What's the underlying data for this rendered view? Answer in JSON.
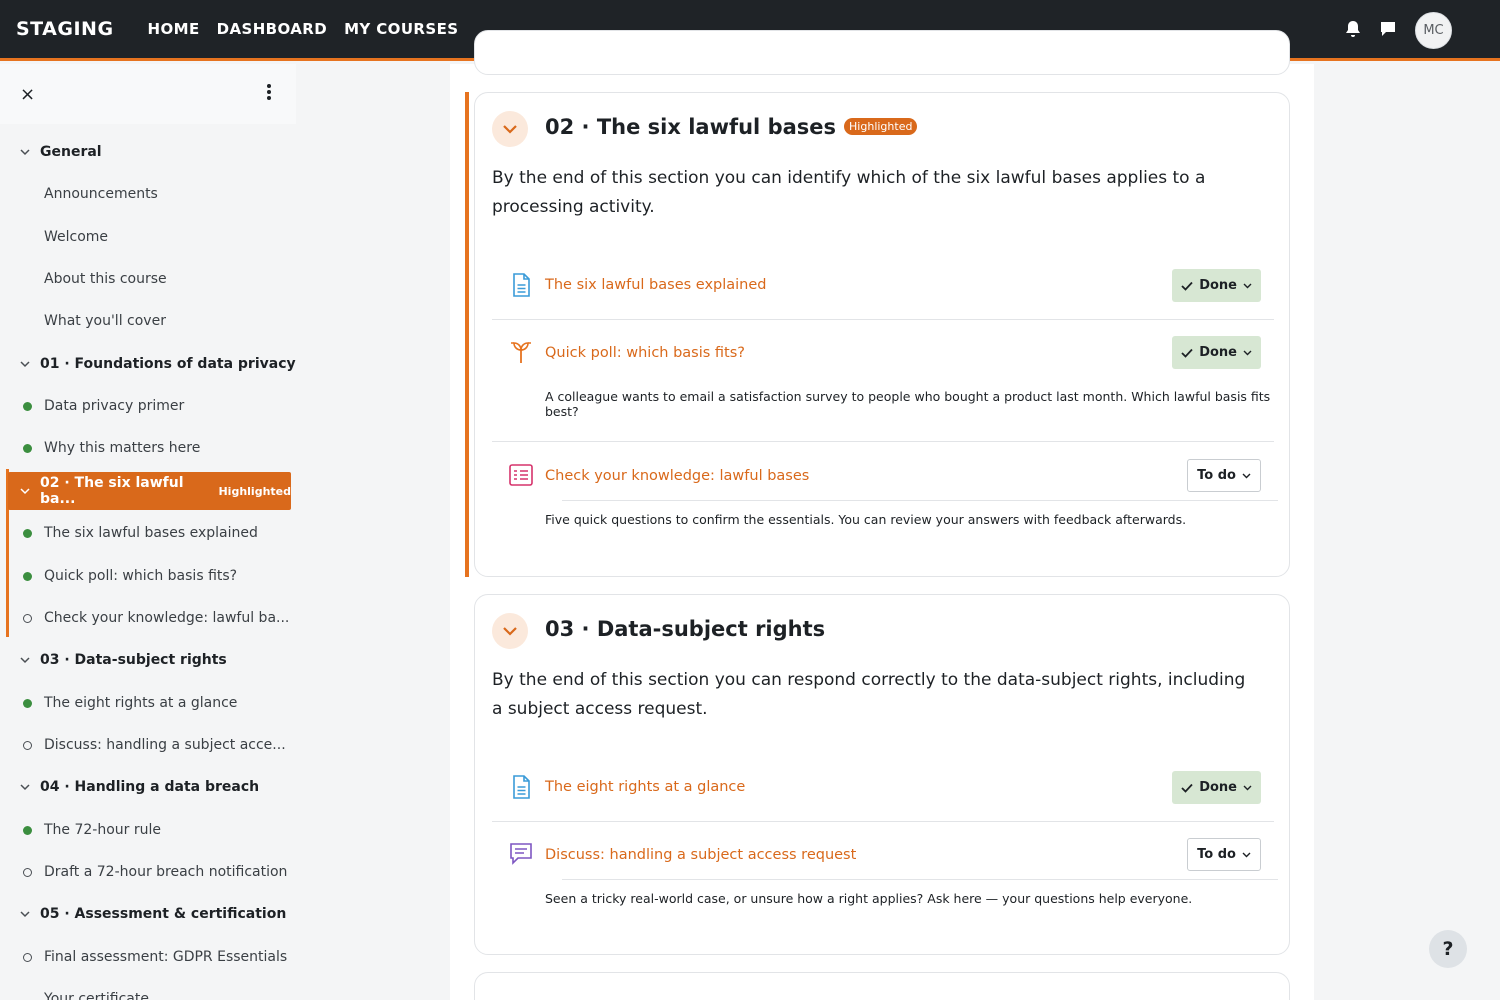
{
  "header": {
    "brand": "STAGING",
    "nav": [
      "HOME",
      "DASHBOARD",
      "MY COURSES"
    ],
    "avatar_initials": "MC",
    "accent_color": "#e6731f"
  },
  "drawer": {
    "close_icon": "×",
    "items": [
      {
        "kind": "section",
        "label": "General"
      },
      {
        "kind": "link",
        "label": "Announcements",
        "status": "none"
      },
      {
        "kind": "link",
        "label": "Welcome",
        "status": "none"
      },
      {
        "kind": "link",
        "label": "About this course",
        "status": "none"
      },
      {
        "kind": "link",
        "label": "What you'll cover",
        "status": "none"
      },
      {
        "kind": "section",
        "label": "01 · Foundations of data privacy"
      },
      {
        "kind": "link",
        "label": "Data privacy primer",
        "status": "done"
      },
      {
        "kind": "link",
        "label": "Why this matters here",
        "status": "done"
      },
      {
        "kind": "section",
        "label": "02 · The six lawful ba...",
        "active": true,
        "badge": "Highlighted"
      },
      {
        "kind": "link",
        "label": "The six lawful bases explained",
        "status": "done"
      },
      {
        "kind": "link",
        "label": "Quick poll: which basis fits?",
        "status": "done"
      },
      {
        "kind": "link",
        "label": "Check your knowledge: lawful ba...",
        "status": "todo"
      },
      {
        "kind": "section",
        "label": "03 · Data-subject rights"
      },
      {
        "kind": "link",
        "label": "The eight rights at a glance",
        "status": "done"
      },
      {
        "kind": "link",
        "label": "Discuss: handling a subject acce...",
        "status": "todo"
      },
      {
        "kind": "section",
        "label": "04 · Handling a data breach"
      },
      {
        "kind": "link",
        "label": "The 72-hour rule",
        "status": "done"
      },
      {
        "kind": "link",
        "label": "Draft a 72-hour breach notification",
        "status": "todo"
      },
      {
        "kind": "section",
        "label": "05 · Assessment & certification"
      },
      {
        "kind": "link",
        "label": "Final assessment: GDPR Essentials",
        "status": "todo"
      },
      {
        "kind": "link",
        "label": "Your certificate",
        "status": "none"
      }
    ]
  },
  "sections": [
    {
      "title": "02 · The six lawful bases",
      "badge": "Highlighted",
      "summary": "By the end of this section you can identify which of the six lawful bases applies to a processing activity.",
      "activities": [
        {
          "icon": "page-icon",
          "name": "The six lawful bases explained",
          "status": "Done",
          "description": ""
        },
        {
          "icon": "choice-icon",
          "name": "Quick poll: which basis fits?",
          "status": "Done",
          "description": "A colleague wants to email a satisfaction survey to people who bought a product last month. Which lawful basis fits best?"
        },
        {
          "icon": "quiz-icon",
          "name": "Check your knowledge: lawful bases",
          "status": "To do",
          "description": "Five quick questions to confirm the essentials. You can review your answers with feedback afterwards."
        }
      ]
    },
    {
      "title": "03 · Data-subject rights",
      "badge": "",
      "summary": "By the end of this section you can respond correctly to the data-subject rights, including a subject access request.",
      "activities": [
        {
          "icon": "page-icon",
          "name": "The eight rights at a glance",
          "status": "Done",
          "description": ""
        },
        {
          "icon": "forum-icon",
          "name": "Discuss: handling a subject access request",
          "status": "To do",
          "description": "Seen a tricky real-world case, or unsure how a right applies? Ask here — your questions help everyone."
        }
      ]
    }
  ],
  "help_label": "?"
}
